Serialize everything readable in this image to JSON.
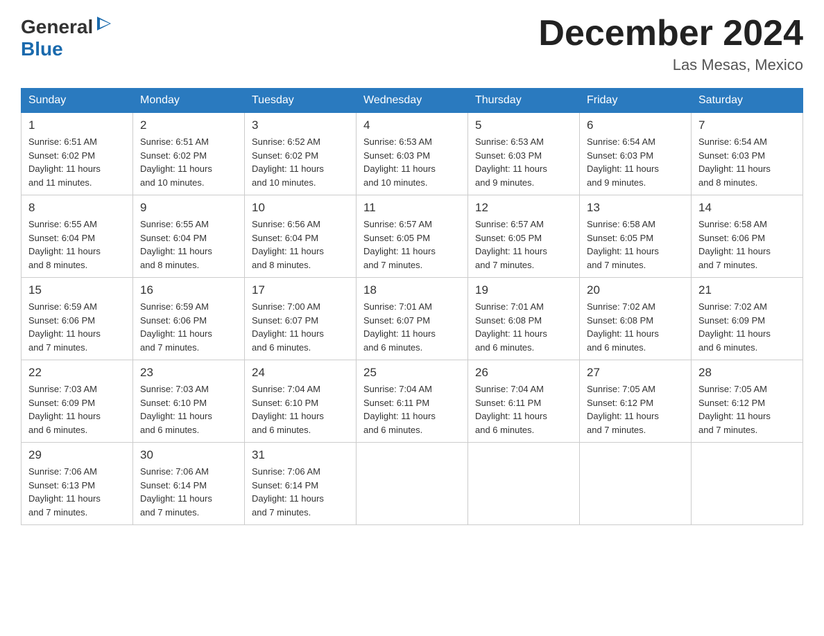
{
  "header": {
    "logo_general": "General",
    "logo_blue": "Blue",
    "title": "December 2024",
    "location": "Las Mesas, Mexico"
  },
  "days_of_week": [
    "Sunday",
    "Monday",
    "Tuesday",
    "Wednesday",
    "Thursday",
    "Friday",
    "Saturday"
  ],
  "weeks": [
    [
      {
        "day": "1",
        "sunrise": "6:51 AM",
        "sunset": "6:02 PM",
        "daylight": "11 hours and 11 minutes."
      },
      {
        "day": "2",
        "sunrise": "6:51 AM",
        "sunset": "6:02 PM",
        "daylight": "11 hours and 10 minutes."
      },
      {
        "day": "3",
        "sunrise": "6:52 AM",
        "sunset": "6:02 PM",
        "daylight": "11 hours and 10 minutes."
      },
      {
        "day": "4",
        "sunrise": "6:53 AM",
        "sunset": "6:03 PM",
        "daylight": "11 hours and 10 minutes."
      },
      {
        "day": "5",
        "sunrise": "6:53 AM",
        "sunset": "6:03 PM",
        "daylight": "11 hours and 9 minutes."
      },
      {
        "day": "6",
        "sunrise": "6:54 AM",
        "sunset": "6:03 PM",
        "daylight": "11 hours and 9 minutes."
      },
      {
        "day": "7",
        "sunrise": "6:54 AM",
        "sunset": "6:03 PM",
        "daylight": "11 hours and 8 minutes."
      }
    ],
    [
      {
        "day": "8",
        "sunrise": "6:55 AM",
        "sunset": "6:04 PM",
        "daylight": "11 hours and 8 minutes."
      },
      {
        "day": "9",
        "sunrise": "6:55 AM",
        "sunset": "6:04 PM",
        "daylight": "11 hours and 8 minutes."
      },
      {
        "day": "10",
        "sunrise": "6:56 AM",
        "sunset": "6:04 PM",
        "daylight": "11 hours and 8 minutes."
      },
      {
        "day": "11",
        "sunrise": "6:57 AM",
        "sunset": "6:05 PM",
        "daylight": "11 hours and 7 minutes."
      },
      {
        "day": "12",
        "sunrise": "6:57 AM",
        "sunset": "6:05 PM",
        "daylight": "11 hours and 7 minutes."
      },
      {
        "day": "13",
        "sunrise": "6:58 AM",
        "sunset": "6:05 PM",
        "daylight": "11 hours and 7 minutes."
      },
      {
        "day": "14",
        "sunrise": "6:58 AM",
        "sunset": "6:06 PM",
        "daylight": "11 hours and 7 minutes."
      }
    ],
    [
      {
        "day": "15",
        "sunrise": "6:59 AM",
        "sunset": "6:06 PM",
        "daylight": "11 hours and 7 minutes."
      },
      {
        "day": "16",
        "sunrise": "6:59 AM",
        "sunset": "6:06 PM",
        "daylight": "11 hours and 7 minutes."
      },
      {
        "day": "17",
        "sunrise": "7:00 AM",
        "sunset": "6:07 PM",
        "daylight": "11 hours and 6 minutes."
      },
      {
        "day": "18",
        "sunrise": "7:01 AM",
        "sunset": "6:07 PM",
        "daylight": "11 hours and 6 minutes."
      },
      {
        "day": "19",
        "sunrise": "7:01 AM",
        "sunset": "6:08 PM",
        "daylight": "11 hours and 6 minutes."
      },
      {
        "day": "20",
        "sunrise": "7:02 AM",
        "sunset": "6:08 PM",
        "daylight": "11 hours and 6 minutes."
      },
      {
        "day": "21",
        "sunrise": "7:02 AM",
        "sunset": "6:09 PM",
        "daylight": "11 hours and 6 minutes."
      }
    ],
    [
      {
        "day": "22",
        "sunrise": "7:03 AM",
        "sunset": "6:09 PM",
        "daylight": "11 hours and 6 minutes."
      },
      {
        "day": "23",
        "sunrise": "7:03 AM",
        "sunset": "6:10 PM",
        "daylight": "11 hours and 6 minutes."
      },
      {
        "day": "24",
        "sunrise": "7:04 AM",
        "sunset": "6:10 PM",
        "daylight": "11 hours and 6 minutes."
      },
      {
        "day": "25",
        "sunrise": "7:04 AM",
        "sunset": "6:11 PM",
        "daylight": "11 hours and 6 minutes."
      },
      {
        "day": "26",
        "sunrise": "7:04 AM",
        "sunset": "6:11 PM",
        "daylight": "11 hours and 6 minutes."
      },
      {
        "day": "27",
        "sunrise": "7:05 AM",
        "sunset": "6:12 PM",
        "daylight": "11 hours and 7 minutes."
      },
      {
        "day": "28",
        "sunrise": "7:05 AM",
        "sunset": "6:12 PM",
        "daylight": "11 hours and 7 minutes."
      }
    ],
    [
      {
        "day": "29",
        "sunrise": "7:06 AM",
        "sunset": "6:13 PM",
        "daylight": "11 hours and 7 minutes."
      },
      {
        "day": "30",
        "sunrise": "7:06 AM",
        "sunset": "6:14 PM",
        "daylight": "11 hours and 7 minutes."
      },
      {
        "day": "31",
        "sunrise": "7:06 AM",
        "sunset": "6:14 PM",
        "daylight": "11 hours and 7 minutes."
      },
      null,
      null,
      null,
      null
    ]
  ],
  "labels": {
    "sunrise": "Sunrise:",
    "sunset": "Sunset:",
    "daylight": "Daylight:"
  }
}
